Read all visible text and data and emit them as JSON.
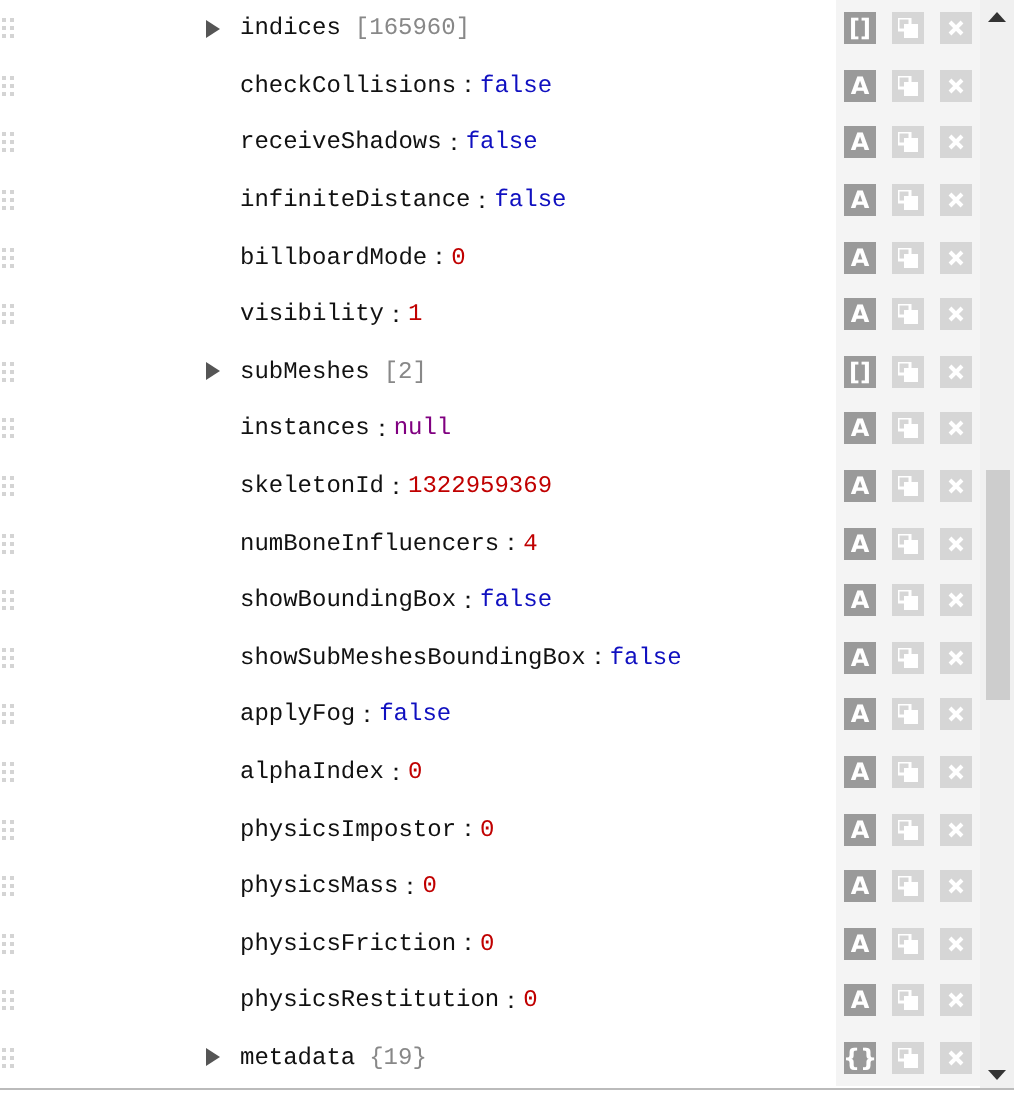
{
  "rows": [
    {
      "kind": "array",
      "key": "indices",
      "count": "[165960]",
      "type_button": "[]"
    },
    {
      "kind": "boolean",
      "key": "checkCollisions",
      "separator": "：",
      "value": "false",
      "type_button": "A"
    },
    {
      "kind": "boolean",
      "key": "receiveShadows",
      "separator": "：",
      "value": "false",
      "type_button": "A"
    },
    {
      "kind": "boolean",
      "key": "infiniteDistance",
      "separator": "：",
      "value": "false",
      "type_button": "A"
    },
    {
      "kind": "number",
      "key": "billboardMode",
      "separator": "：",
      "value": "0",
      "type_button": "A"
    },
    {
      "kind": "number",
      "key": "visibility",
      "separator": "：",
      "value": "1",
      "type_button": "A"
    },
    {
      "kind": "array",
      "key": "subMeshes",
      "count": "[2]",
      "type_button": "[]"
    },
    {
      "kind": "null",
      "key": "instances",
      "separator": "：",
      "value": "null",
      "type_button": "A"
    },
    {
      "kind": "number",
      "key": "skeletonId",
      "separator": "：",
      "value": "1322959369",
      "type_button": "A"
    },
    {
      "kind": "number",
      "key": "numBoneInfluencers",
      "separator": "：",
      "value": "4",
      "type_button": "A"
    },
    {
      "kind": "boolean",
      "key": "showBoundingBox",
      "separator": "：",
      "value": "false",
      "type_button": "A"
    },
    {
      "kind": "boolean",
      "key": "showSubMeshesBoundingBox",
      "separator": "：",
      "value": "false",
      "type_button": "A"
    },
    {
      "kind": "boolean",
      "key": "applyFog",
      "separator": "：",
      "value": "false",
      "type_button": "A"
    },
    {
      "kind": "number",
      "key": "alphaIndex",
      "separator": "：",
      "value": "0",
      "type_button": "A"
    },
    {
      "kind": "number",
      "key": "physicsImpostor",
      "separator": "：",
      "value": "0",
      "type_button": "A"
    },
    {
      "kind": "number",
      "key": "physicsMass",
      "separator": "：",
      "value": "0",
      "type_button": "A"
    },
    {
      "kind": "number",
      "key": "physicsFriction",
      "separator": "：",
      "value": "0",
      "type_button": "A"
    },
    {
      "kind": "number",
      "key": "physicsRestitution",
      "separator": "：",
      "value": "0",
      "type_button": "A"
    },
    {
      "kind": "object",
      "key": "metadata",
      "count": "{19}",
      "type_button": "{}"
    }
  ]
}
